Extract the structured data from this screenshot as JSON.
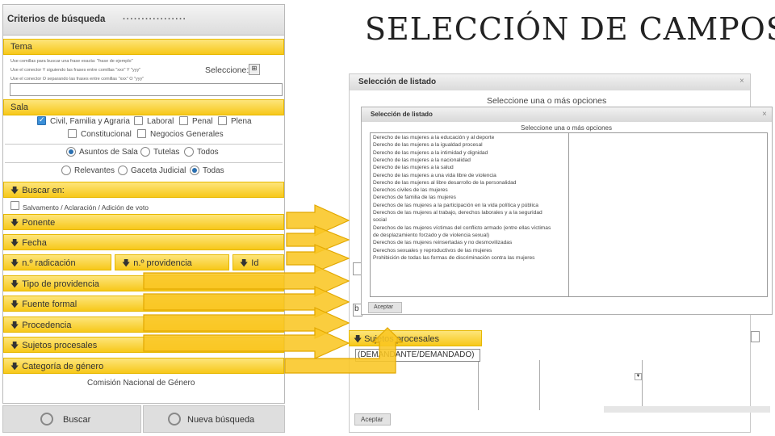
{
  "title": "SELECCIÓN DE CAMPOS",
  "left_panel": {
    "header": "Criterios de búsqueda",
    "dots": "·················",
    "tema": {
      "label": "Tema",
      "help_lines": [
        "Use comillas para buscar una frase exacta: \"frase de ejemplo\"",
        "Use el conector Y siguiendo las frases entre comillas \"xxx\" Y \"yyy\"",
        "Use el conector O separando las frases entre comillas \"xxx\" O \"yyy\""
      ],
      "select_label": "Seleccione:"
    },
    "sala": {
      "label": "Sala",
      "checkboxes": [
        {
          "label": "Civil, Familia y Agraria",
          "checked": true
        },
        {
          "label": "Laboral",
          "checked": false
        },
        {
          "label": "Penal",
          "checked": false
        },
        {
          "label": "Plena",
          "checked": false
        },
        {
          "label": "Constitucional",
          "checked": false
        },
        {
          "label": "Negocios Generales",
          "checked": false
        }
      ],
      "radios_1": [
        {
          "label": "Asuntos de Sala",
          "checked": true
        },
        {
          "label": "Tutelas",
          "checked": false
        },
        {
          "label": "Todos",
          "checked": false
        }
      ],
      "radios_2": [
        {
          "label": "Relevantes",
          "checked": false
        },
        {
          "label": "Gaceta Judicial",
          "checked": false
        },
        {
          "label": "Todas",
          "checked": true
        }
      ]
    },
    "buscar_en": {
      "label": "Buscar en:",
      "option": "Salvamento / Aclaración / Adición de voto"
    },
    "bars": {
      "ponente": "Ponente",
      "fecha": "Fecha",
      "radicacion": "n.º radicación",
      "providencia_num": "n.º providencia",
      "id": "Id",
      "tipo": "Tipo de providencia",
      "fuente": "Fuente formal",
      "procedencia": "Procedencia",
      "sujetos": "Sujetos procesales",
      "genero": "Categoría de género"
    },
    "footer_text": "Comisión Nacional de Género",
    "buttons": {
      "search": "Buscar",
      "new_search": "Nueva búsqueda"
    }
  },
  "back_dialog": {
    "title": "Selección de listado",
    "subtitle": "Seleccione una o más opciones",
    "close": "×",
    "accept": "Aceptar"
  },
  "front_dialog": {
    "title": "Selección de listado",
    "subtitle": "Seleccione una o más opciones",
    "close": "×",
    "items": [
      "Derecho de las mujeres a la educación y al deporte",
      "Derecho de las mujeres a la igualdad procesal",
      "Derecho de las mujeres a la intimidad y dignidad",
      "Derecho de las mujeres a la nacionalidad",
      "Derecho de las mujeres a la salud",
      "Derecho de las mujeres a una vida libre de violencia",
      "Derecho de las mujeres al libre desarrollo de la personalidad",
      "Derechos civiles de las mujeres",
      "Derechos de familia de las mujeres",
      "Derechos de las mujeres a la participación en la vida política y pública",
      "Derechos de las mujeres al trabajo, derechos laborales y a la seguridad",
      "social",
      "Derechos de las mujeres víctimas del conflicto armado (entre ellas víctimas",
      "de desplazamiento forzado y de violencia sexual)",
      "Derechos de las mujeres reinsertadas y no desmovilizadas",
      "Derechos sexuales y reproductivos de las mujeres",
      "Prohibición de todas las formas de discriminación contra las mujeres"
    ],
    "accept": "Aceptar"
  },
  "behind": {
    "sujetos_label": "Sujetos procesales",
    "sujetos_value": "(DEMANDANTE/DEMANDADO)",
    "peek_letter": "b"
  }
}
